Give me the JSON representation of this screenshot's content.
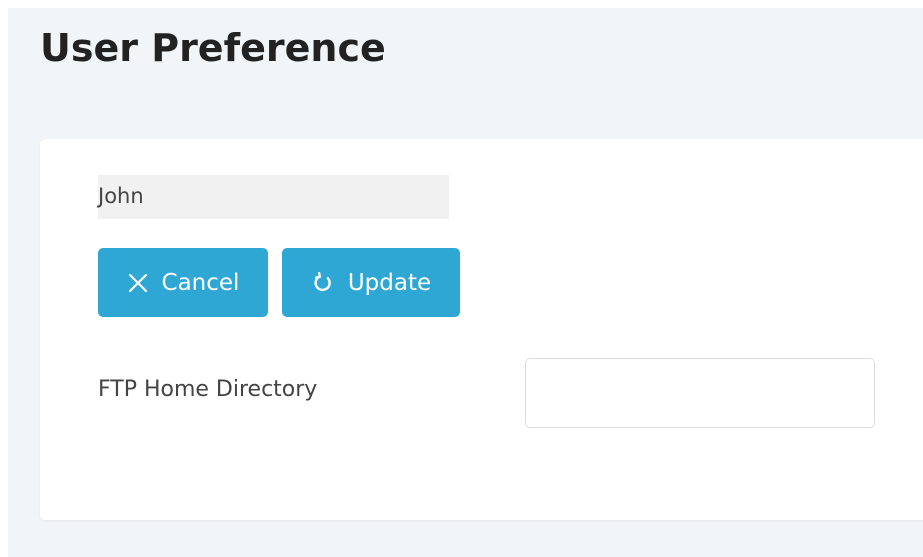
{
  "page": {
    "title": "User Preference"
  },
  "form": {
    "username_value": "John",
    "cancel_label": "Cancel",
    "update_label": "Update",
    "ftp_home_label": "FTP Home Directory",
    "ftp_home_value": "",
    "ftp_home_placeholder": ""
  },
  "icons": {
    "cancel": "close-icon",
    "update": "refresh-icon"
  },
  "colors": {
    "page_background": "#f2f5f8",
    "button_primary": "#2ea7d5",
    "card_background": "#ffffff"
  }
}
